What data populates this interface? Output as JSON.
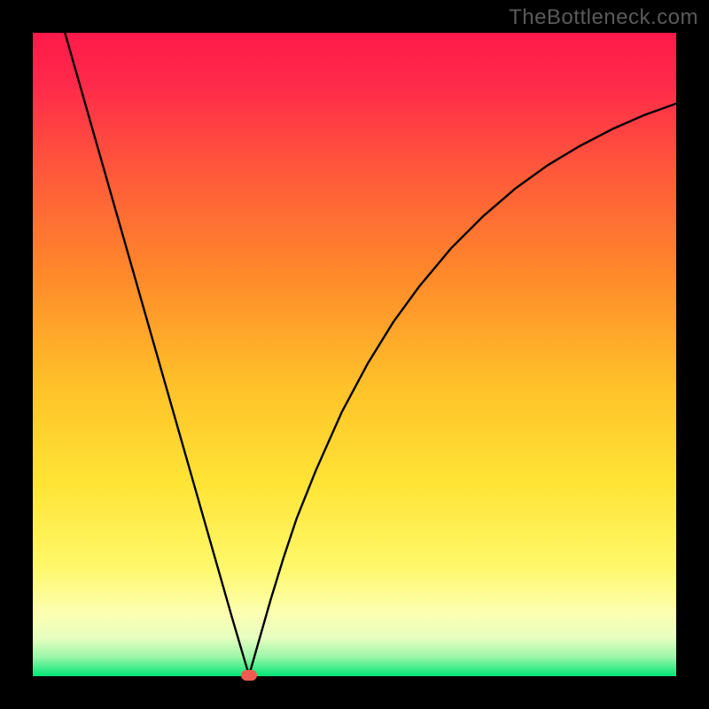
{
  "watermark": "TheBottleneck.com",
  "chart_data": {
    "type": "line",
    "title": "",
    "xlabel": "",
    "ylabel": "",
    "xlim": [
      0,
      100
    ],
    "ylim": [
      0,
      100
    ],
    "grid": false,
    "legend": false,
    "background_gradient": {
      "top": "#ff1a4a",
      "upper_mid": "#ff8a2a",
      "mid": "#ffd830",
      "lower_mid": "#fff99a",
      "bottom": "#00e676"
    },
    "series": [
      {
        "name": "bottleneck-curve",
        "x": [
          5,
          7,
          9,
          11,
          13,
          15,
          17,
          19,
          21,
          23,
          25,
          27,
          29,
          31,
          33,
          33.6,
          34,
          35,
          37,
          39,
          41,
          44,
          48,
          52,
          56,
          60,
          65,
          70,
          75,
          80,
          85,
          90,
          95,
          100
        ],
        "y": [
          100,
          93,
          86,
          79,
          72,
          65,
          58,
          51,
          44,
          37,
          30,
          23,
          16,
          9,
          2.2,
          0.2,
          1.5,
          5,
          12,
          18.5,
          24.5,
          32,
          41,
          48.5,
          55,
          60.5,
          66.5,
          71.5,
          75.8,
          79.4,
          82.4,
          85,
          87.2,
          89
        ]
      }
    ],
    "marker": {
      "name": "optimal-point",
      "x": 33.6,
      "y": 0.2,
      "color": "#f05a4f"
    }
  }
}
